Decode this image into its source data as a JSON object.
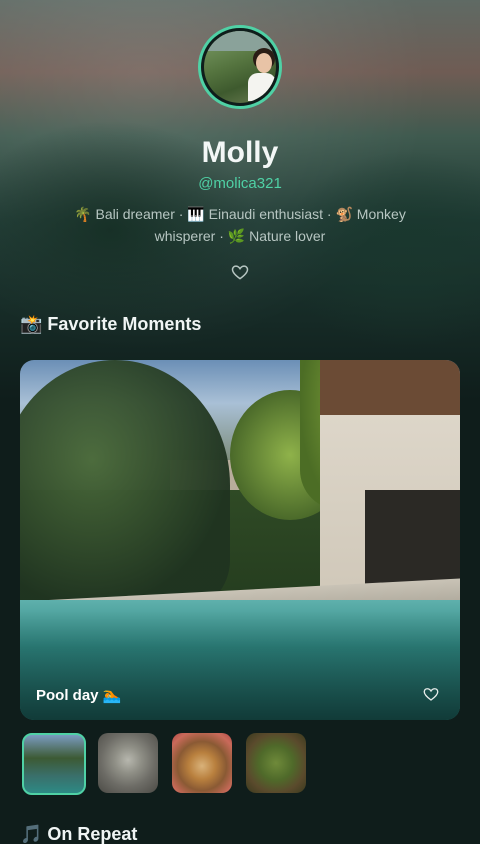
{
  "profile": {
    "name": "Molly",
    "handle": "@molica321",
    "bio": "🌴 Bali dreamer · 🎹 Einaudi enthusiast · 🐒 Monkey whisperer · 🌿 Nature lover"
  },
  "sections": {
    "favorite_moments_title": "📸 Favorite Moments",
    "on_repeat_title": "🎵 On Repeat"
  },
  "featured_moment": {
    "caption": "Pool day 🏊"
  },
  "thumbnails": [
    {
      "id": "pool",
      "active": true
    },
    {
      "id": "monkey",
      "active": false
    },
    {
      "id": "food",
      "active": false
    },
    {
      "id": "plants",
      "active": false
    }
  ],
  "colors": {
    "accent": "#4fd1a5",
    "background": "#0f1d1b"
  },
  "icons": {
    "like": "heart-outline-icon"
  }
}
